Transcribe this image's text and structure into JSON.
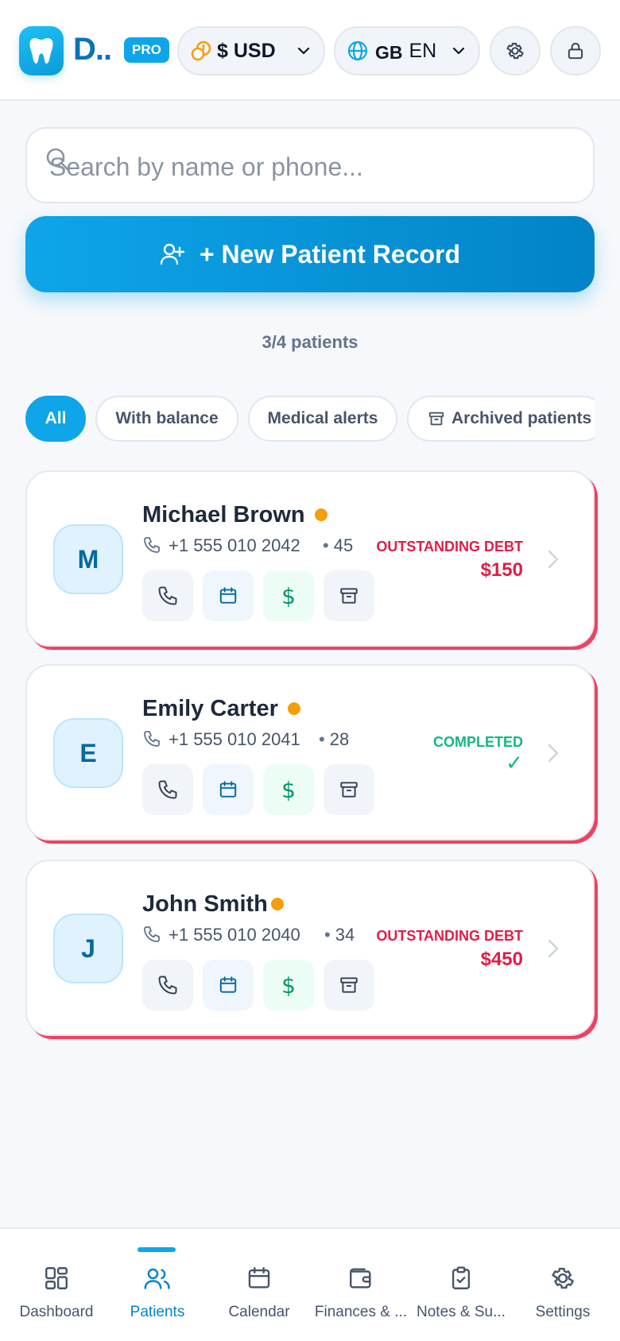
{
  "header": {
    "app_name": "D..",
    "badge": "PRO",
    "currency": {
      "label": "$ USD",
      "icon": "coins-icon"
    },
    "language": {
      "flag": "GB",
      "code": "EN",
      "icon": "globe-icon"
    },
    "settings_icon": "gear-icon",
    "lock_icon": "lock-icon"
  },
  "search": {
    "placeholder": "Search by name or phone...",
    "value": ""
  },
  "new_record": {
    "label": "+ New Patient Record",
    "icon": "user-plus-icon"
  },
  "count_text": "3/4 patients",
  "filters": [
    {
      "label": "All",
      "active": true
    },
    {
      "label": "With balance",
      "active": false
    },
    {
      "label": "Medical alerts",
      "active": false
    },
    {
      "label": "Archived patients",
      "active": false,
      "icon": "archive-icon"
    }
  ],
  "patients": [
    {
      "initial": "M",
      "name": "Michael Brown",
      "phone": "+1 555 010 2042",
      "age": "45",
      "status_label": "OUTSTANDING DEBT",
      "status_value": "$150",
      "status": "debt"
    },
    {
      "initial": "E",
      "name": "Emily Carter",
      "phone": "+1 555 010 2041",
      "age": "28",
      "status_label": "COMPLETED",
      "status_value": "✓",
      "status": "completed"
    },
    {
      "initial": "J",
      "name": "John Smith",
      "phone": "+1 555 010 2040",
      "age": "34",
      "status_label": "OUTSTANDING DEBT",
      "status_value": "$450",
      "status": "debt"
    }
  ],
  "nav": [
    {
      "label": "Dashboard",
      "icon": "grid-icon",
      "active": false
    },
    {
      "label": "Patients",
      "icon": "users-icon",
      "active": true
    },
    {
      "label": "Calendar",
      "icon": "calendar-icon",
      "active": false
    },
    {
      "label": "Finances & ...",
      "icon": "wallet-icon",
      "active": false
    },
    {
      "label": "Notes & Su...",
      "icon": "clipboard-check-icon",
      "active": false
    },
    {
      "label": "Settings",
      "icon": "gear-icon",
      "active": false
    }
  ],
  "colors": {
    "accent": "#0ea5e9",
    "debt": "#e11d48",
    "completed": "#10b981",
    "pending_dot": "#f59e0b"
  }
}
